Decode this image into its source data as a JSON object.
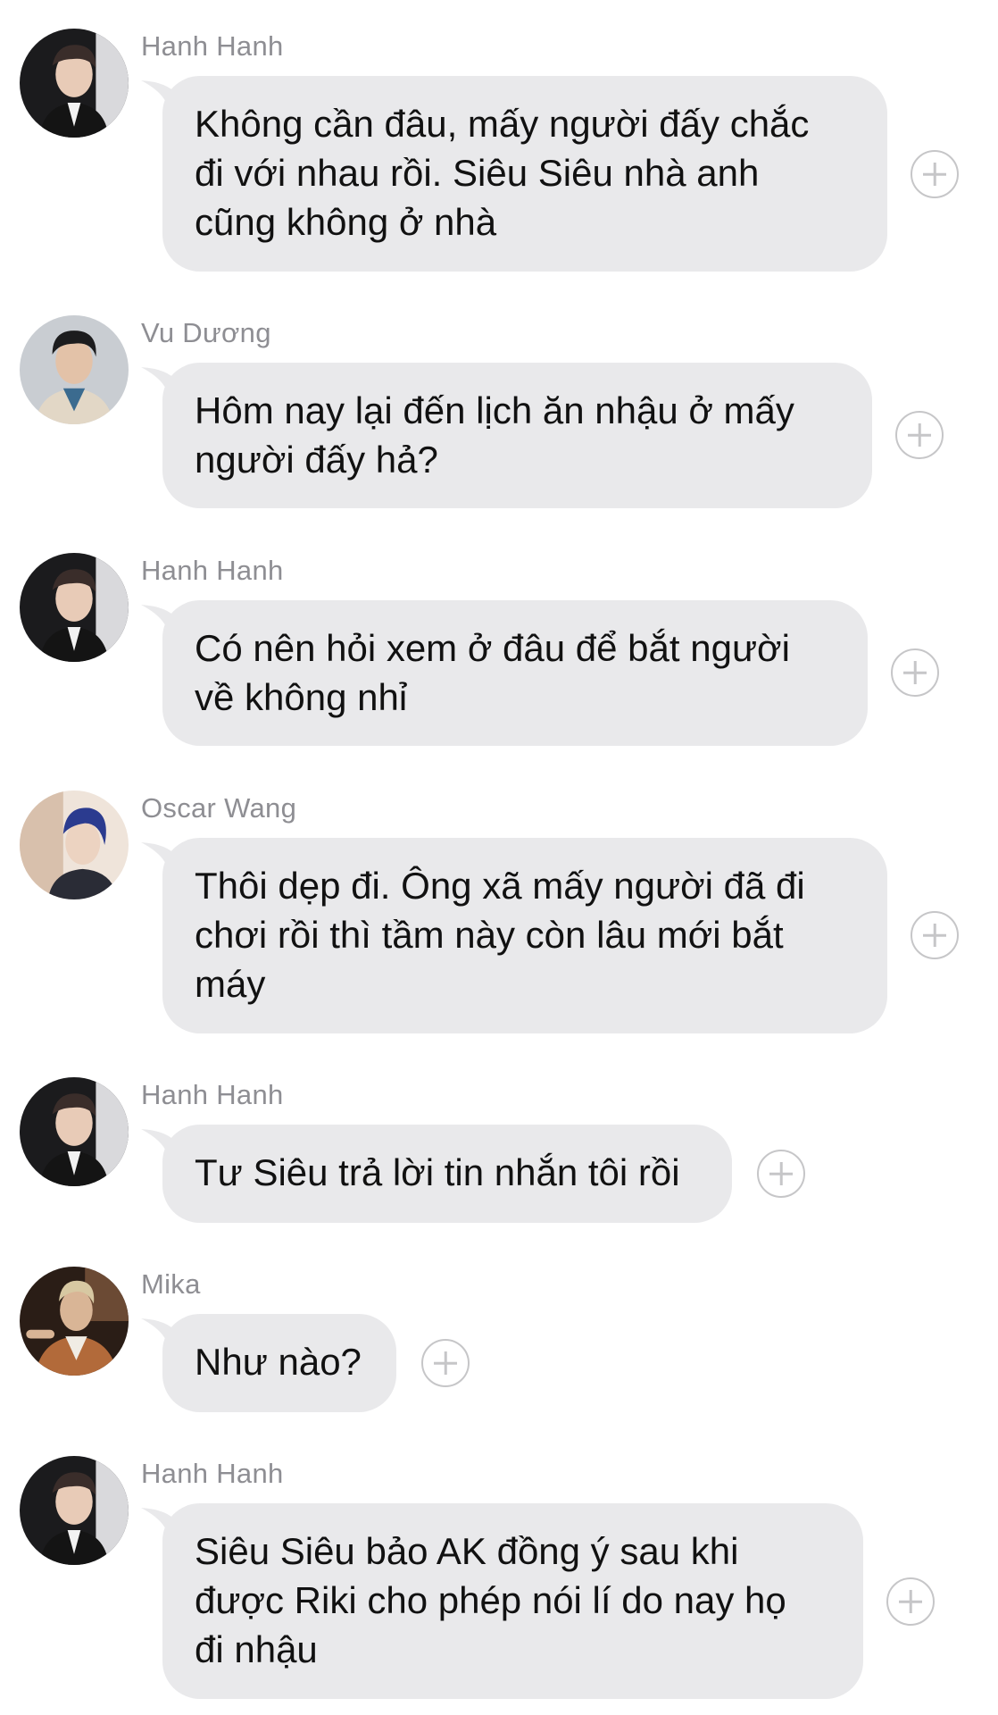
{
  "messages": [
    {
      "sender": "Hanh Hanh",
      "avatar_icon": "avatar-hanh-hanh",
      "text": "Không cần đâu, mấy người đấy chắc\nđi với nhau rồi. Siêu Siêu nhà anh\ncũng không ở nhà"
    },
    {
      "sender": "Vu Dương",
      "avatar_icon": "avatar-vu-duong",
      "text": "Hôm nay lại đến lịch ăn nhậu ở mấy\nngười đấy hả?"
    },
    {
      "sender": "Hanh Hanh",
      "avatar_icon": "avatar-hanh-hanh",
      "text": "Có nên hỏi xem ở đâu để bắt người\nvề không nhỉ"
    },
    {
      "sender": "Oscar Wang",
      "avatar_icon": "avatar-oscar-wang",
      "text": "Thôi dẹp đi. Ông xã mấy người đã đi\nchơi rồi thì tầm này còn lâu mới bắt\nmáy"
    },
    {
      "sender": "Hanh Hanh",
      "avatar_icon": "avatar-hanh-hanh",
      "text": "Tư Siêu trả lời tin nhắn tôi rồi"
    },
    {
      "sender": "Mika",
      "avatar_icon": "avatar-mika",
      "text": "Như nào?"
    },
    {
      "sender": "Hanh Hanh",
      "avatar_icon": "avatar-hanh-hanh",
      "text": "Siêu Siêu bảo AK đồng ý sau khi\nđược Riki cho phép nói lí do nay họ\nđi nhậu"
    }
  ],
  "add_reaction_icon": "plus-circle-icon",
  "colors": {
    "bubble": "#e9e9eb",
    "sender": "#8e8e93",
    "text": "#111111",
    "add_icon": "#c6c6c8"
  }
}
